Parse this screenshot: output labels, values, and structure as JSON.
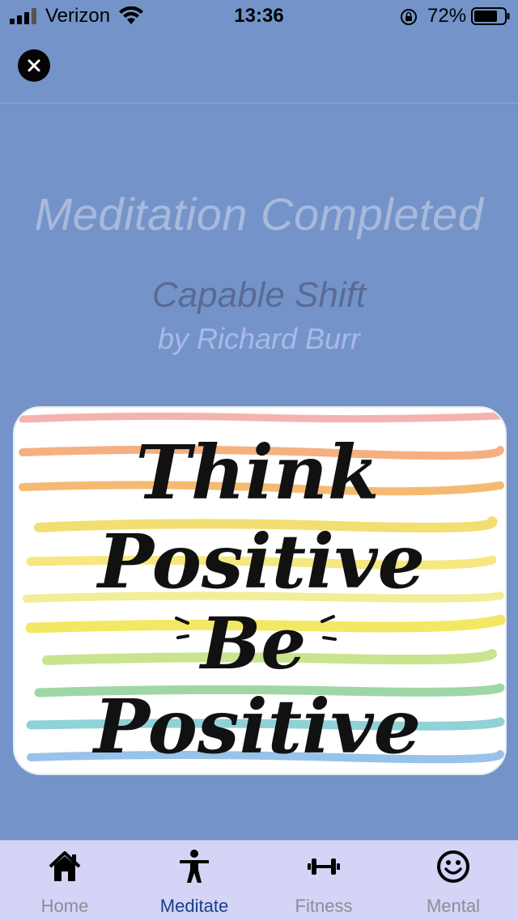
{
  "status_bar": {
    "carrier": "Verizon",
    "time": "13:36",
    "battery_percent": "72%"
  },
  "header": {
    "close_icon": "close-icon"
  },
  "content": {
    "headline": "Meditation Completed",
    "track_title": "Capable Shift",
    "track_author": "by Richard Burr",
    "artwork": {
      "lines": [
        "Think",
        "Positive",
        "Be",
        "Positive"
      ]
    }
  },
  "tab_bar": {
    "active": "Meditate",
    "tabs": [
      {
        "label": "Home",
        "icon": "home-icon"
      },
      {
        "label": "Meditate",
        "icon": "person-icon"
      },
      {
        "label": "Fitness",
        "icon": "dumbbell-icon"
      },
      {
        "label": "Mental",
        "icon": "smiley-icon"
      }
    ]
  },
  "colors": {
    "background": "#7494c9",
    "tab_bar": "#d3d4f6",
    "active_tab": "#1b3e8a"
  }
}
